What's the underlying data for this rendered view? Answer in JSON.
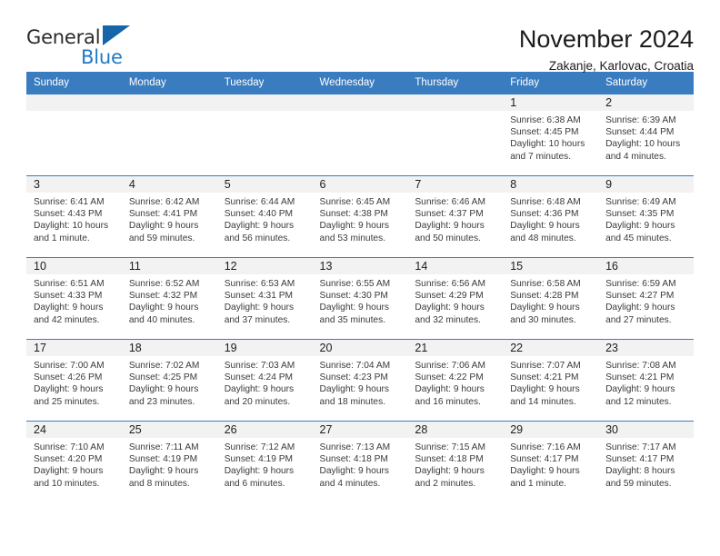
{
  "brand": {
    "name_part1": "General",
    "name_part2": "Blue",
    "flag_icon": "triangle-flag-icon",
    "accent_color": "#1f7ac4",
    "flag_color": "#1565a8"
  },
  "header": {
    "month_title": "November 2024",
    "location": "Zakanje, Karlovac, Croatia"
  },
  "calendar": {
    "header_bg": "#3a7cc0",
    "daynum_bg": "#f2f2f2",
    "weekdays": [
      "Sunday",
      "Monday",
      "Tuesday",
      "Wednesday",
      "Thursday",
      "Friday",
      "Saturday"
    ],
    "weeks": [
      [
        {
          "day": "",
          "empty": true
        },
        {
          "day": "",
          "empty": true
        },
        {
          "day": "",
          "empty": true
        },
        {
          "day": "",
          "empty": true
        },
        {
          "day": "",
          "empty": true
        },
        {
          "day": "1",
          "sunrise": "Sunrise: 6:38 AM",
          "sunset": "Sunset: 4:45 PM",
          "daylight": "Daylight: 10 hours and 7 minutes."
        },
        {
          "day": "2",
          "sunrise": "Sunrise: 6:39 AM",
          "sunset": "Sunset: 4:44 PM",
          "daylight": "Daylight: 10 hours and 4 minutes."
        }
      ],
      [
        {
          "day": "3",
          "sunrise": "Sunrise: 6:41 AM",
          "sunset": "Sunset: 4:43 PM",
          "daylight": "Daylight: 10 hours and 1 minute."
        },
        {
          "day": "4",
          "sunrise": "Sunrise: 6:42 AM",
          "sunset": "Sunset: 4:41 PM",
          "daylight": "Daylight: 9 hours and 59 minutes."
        },
        {
          "day": "5",
          "sunrise": "Sunrise: 6:44 AM",
          "sunset": "Sunset: 4:40 PM",
          "daylight": "Daylight: 9 hours and 56 minutes."
        },
        {
          "day": "6",
          "sunrise": "Sunrise: 6:45 AM",
          "sunset": "Sunset: 4:38 PM",
          "daylight": "Daylight: 9 hours and 53 minutes."
        },
        {
          "day": "7",
          "sunrise": "Sunrise: 6:46 AM",
          "sunset": "Sunset: 4:37 PM",
          "daylight": "Daylight: 9 hours and 50 minutes."
        },
        {
          "day": "8",
          "sunrise": "Sunrise: 6:48 AM",
          "sunset": "Sunset: 4:36 PM",
          "daylight": "Daylight: 9 hours and 48 minutes."
        },
        {
          "day": "9",
          "sunrise": "Sunrise: 6:49 AM",
          "sunset": "Sunset: 4:35 PM",
          "daylight": "Daylight: 9 hours and 45 minutes."
        }
      ],
      [
        {
          "day": "10",
          "sunrise": "Sunrise: 6:51 AM",
          "sunset": "Sunset: 4:33 PM",
          "daylight": "Daylight: 9 hours and 42 minutes."
        },
        {
          "day": "11",
          "sunrise": "Sunrise: 6:52 AM",
          "sunset": "Sunset: 4:32 PM",
          "daylight": "Daylight: 9 hours and 40 minutes."
        },
        {
          "day": "12",
          "sunrise": "Sunrise: 6:53 AM",
          "sunset": "Sunset: 4:31 PM",
          "daylight": "Daylight: 9 hours and 37 minutes."
        },
        {
          "day": "13",
          "sunrise": "Sunrise: 6:55 AM",
          "sunset": "Sunset: 4:30 PM",
          "daylight": "Daylight: 9 hours and 35 minutes."
        },
        {
          "day": "14",
          "sunrise": "Sunrise: 6:56 AM",
          "sunset": "Sunset: 4:29 PM",
          "daylight": "Daylight: 9 hours and 32 minutes."
        },
        {
          "day": "15",
          "sunrise": "Sunrise: 6:58 AM",
          "sunset": "Sunset: 4:28 PM",
          "daylight": "Daylight: 9 hours and 30 minutes."
        },
        {
          "day": "16",
          "sunrise": "Sunrise: 6:59 AM",
          "sunset": "Sunset: 4:27 PM",
          "daylight": "Daylight: 9 hours and 27 minutes."
        }
      ],
      [
        {
          "day": "17",
          "sunrise": "Sunrise: 7:00 AM",
          "sunset": "Sunset: 4:26 PM",
          "daylight": "Daylight: 9 hours and 25 minutes."
        },
        {
          "day": "18",
          "sunrise": "Sunrise: 7:02 AM",
          "sunset": "Sunset: 4:25 PM",
          "daylight": "Daylight: 9 hours and 23 minutes."
        },
        {
          "day": "19",
          "sunrise": "Sunrise: 7:03 AM",
          "sunset": "Sunset: 4:24 PM",
          "daylight": "Daylight: 9 hours and 20 minutes."
        },
        {
          "day": "20",
          "sunrise": "Sunrise: 7:04 AM",
          "sunset": "Sunset: 4:23 PM",
          "daylight": "Daylight: 9 hours and 18 minutes."
        },
        {
          "day": "21",
          "sunrise": "Sunrise: 7:06 AM",
          "sunset": "Sunset: 4:22 PM",
          "daylight": "Daylight: 9 hours and 16 minutes."
        },
        {
          "day": "22",
          "sunrise": "Sunrise: 7:07 AM",
          "sunset": "Sunset: 4:21 PM",
          "daylight": "Daylight: 9 hours and 14 minutes."
        },
        {
          "day": "23",
          "sunrise": "Sunrise: 7:08 AM",
          "sunset": "Sunset: 4:21 PM",
          "daylight": "Daylight: 9 hours and 12 minutes."
        }
      ],
      [
        {
          "day": "24",
          "sunrise": "Sunrise: 7:10 AM",
          "sunset": "Sunset: 4:20 PM",
          "daylight": "Daylight: 9 hours and 10 minutes."
        },
        {
          "day": "25",
          "sunrise": "Sunrise: 7:11 AM",
          "sunset": "Sunset: 4:19 PM",
          "daylight": "Daylight: 9 hours and 8 minutes."
        },
        {
          "day": "26",
          "sunrise": "Sunrise: 7:12 AM",
          "sunset": "Sunset: 4:19 PM",
          "daylight": "Daylight: 9 hours and 6 minutes."
        },
        {
          "day": "27",
          "sunrise": "Sunrise: 7:13 AM",
          "sunset": "Sunset: 4:18 PM",
          "daylight": "Daylight: 9 hours and 4 minutes."
        },
        {
          "day": "28",
          "sunrise": "Sunrise: 7:15 AM",
          "sunset": "Sunset: 4:18 PM",
          "daylight": "Daylight: 9 hours and 2 minutes."
        },
        {
          "day": "29",
          "sunrise": "Sunrise: 7:16 AM",
          "sunset": "Sunset: 4:17 PM",
          "daylight": "Daylight: 9 hours and 1 minute."
        },
        {
          "day": "30",
          "sunrise": "Sunrise: 7:17 AM",
          "sunset": "Sunset: 4:17 PM",
          "daylight": "Daylight: 8 hours and 59 minutes."
        }
      ]
    ]
  }
}
